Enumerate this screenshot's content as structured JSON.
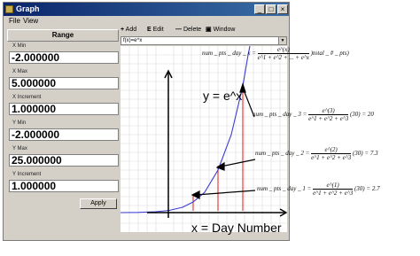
{
  "window": {
    "title": "Graph",
    "minimize": "_",
    "maximize": "□",
    "close": "×"
  },
  "menu": {
    "file": "File",
    "view": "View"
  },
  "range": {
    "header": "Range",
    "fields": [
      {
        "label": "X Min",
        "value": "-2.000000"
      },
      {
        "label": "X Max",
        "value": "5.000000"
      },
      {
        "label": "X Increment",
        "value": "1.000000"
      },
      {
        "label": "Y Min",
        "value": "-2.000000"
      },
      {
        "label": "Y Max",
        "value": "25.000000"
      },
      {
        "label": "Y Increment",
        "value": "1.000000"
      }
    ],
    "apply": "Apply"
  },
  "toolbar": {
    "add": "Add",
    "edit": "Edit",
    "delete": "Delete",
    "window": "Window"
  },
  "function_box": {
    "value": "f(x)=e^x"
  },
  "plot": {
    "curve_label": "y = e^x",
    "xaxis_label": "x = Day Number",
    "curve_color": "#3b3bd6",
    "line_color": "#e01818"
  },
  "annotations": {
    "formula_top": "num _ pts _ day _ x = (e^(x) / (e^1 + e^2 + ... + e^x)) total _ # _ pts)",
    "day3": "num _ pts _ day _ 3 = (e^(3) / (e^1 + e^2 + e^3)) (30) = 20",
    "day2": "num _ pts _ day _ 2 = (e^(2) / (e^1 + e^2 + e^3)) (30) = 7.3",
    "day1": "num _ pts _ day _ 1 = (e^(1) / (e^1 + e^2 + e^3)) (30) = 2.7",
    "num_pts_mid": "num _ pts",
    "top_lhs": "num _ pts _ day _ x =",
    "top_num": "e^(x)",
    "top_den": "e^1 + e^2 + ... + e^x",
    "top_tail": ")total _ # _ pts)",
    "d3_lhs": "num _ pts _ day _ 3 =",
    "d3_num": "e^(3)",
    "d3_den": "e^1 + e^2 + e^3",
    "d3_tail": "(30) = 20",
    "d2_lhs": "num _ pts _ day _ 2 =",
    "d2_num": "e^(2)",
    "d2_den": "e^1 + e^2 + e^3",
    "d2_tail": "(30) = 7.3",
    "d1_lhs": "num _ pts _ day _ 1 =",
    "d1_num": "e^(1)",
    "d1_den": "e^1 + e^2 + e^3",
    "d1_tail": "(30) = 2.7"
  }
}
